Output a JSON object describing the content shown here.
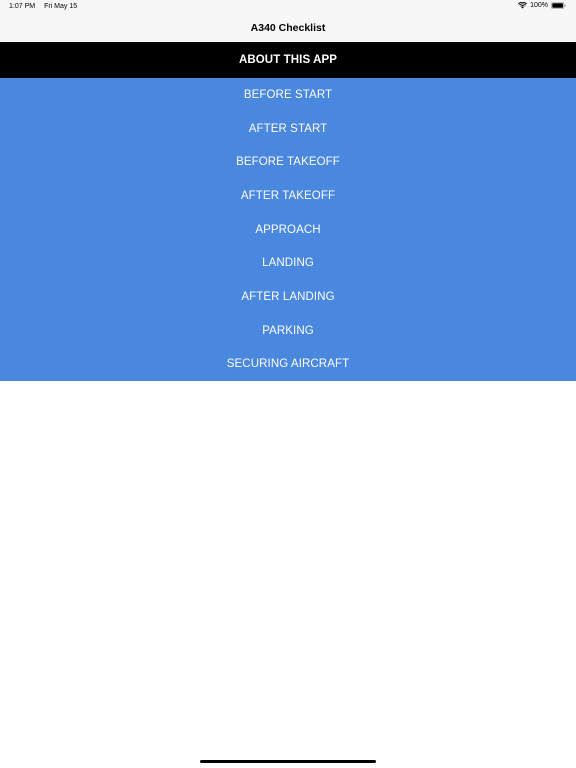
{
  "status_bar": {
    "time": "1:07 PM",
    "date": "Fri May 15",
    "battery": "100%",
    "icons": [
      "wifi-icon",
      "battery-icon"
    ]
  },
  "nav": {
    "title": "A340 Checklist"
  },
  "about": {
    "label": "ABOUT THIS APP"
  },
  "menu": {
    "items": [
      {
        "label": "BEFORE START"
      },
      {
        "label": "AFTER START"
      },
      {
        "label": "BEFORE TAKEOFF"
      },
      {
        "label": "AFTER TAKEOFF"
      },
      {
        "label": "APPROACH"
      },
      {
        "label": "LANDING"
      },
      {
        "label": "AFTER LANDING"
      },
      {
        "label": "PARKING"
      },
      {
        "label": "SECURING AIRCRAFT"
      }
    ]
  },
  "colors": {
    "menu_background": "#4a87df",
    "about_background": "#000000",
    "bar_background": "#f7f7f7"
  }
}
